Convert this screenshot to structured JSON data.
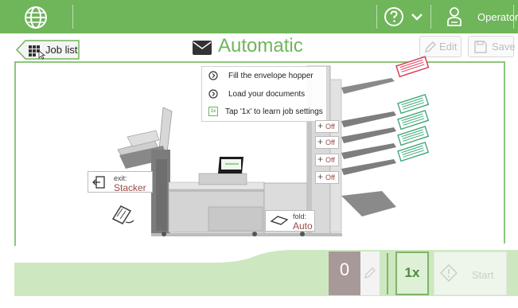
{
  "colors": {
    "brand_green": "#6fb55a",
    "frame_green": "#8cc67a",
    "value_red": "#9b4a4a",
    "tray_green": "#3fa978",
    "tray_red": "#d9405a"
  },
  "topbar": {
    "logo_icon": "globe-icon",
    "help_icon": "question-circle-icon",
    "dropdown_icon": "chevron-down-icon",
    "operator_icon": "operator-person-icon",
    "operator_label": "Operator"
  },
  "header": {
    "job_list_label": "Job list",
    "job_list_icon": "grid-icon",
    "title_icon": "envelope-icon",
    "title": "Automatic",
    "edit_label": "Edit",
    "save_label": "Save"
  },
  "instructions": [
    {
      "icon": "chevron-circle-icon",
      "text": "Fill the envelope hopper"
    },
    {
      "icon": "chevron-circle-icon",
      "text": "Load your documents"
    },
    {
      "icon": "one-x-icon",
      "icon_text": "1x",
      "text": "Tap '1x' to learn job settings"
    }
  ],
  "machine": {
    "exit_label": "exit:",
    "exit_value": "Stacker",
    "fold_label": "fold:",
    "fold_value": "Auto",
    "tray_toggles": [
      {
        "plus": "+",
        "state": "Off"
      },
      {
        "plus": "+",
        "state": "Off"
      },
      {
        "plus": "+",
        "state": "Off"
      },
      {
        "plus": "+",
        "state": "Off"
      }
    ]
  },
  "bottom": {
    "counter": "0",
    "one_x_label": "1x",
    "start_label": "Start"
  }
}
